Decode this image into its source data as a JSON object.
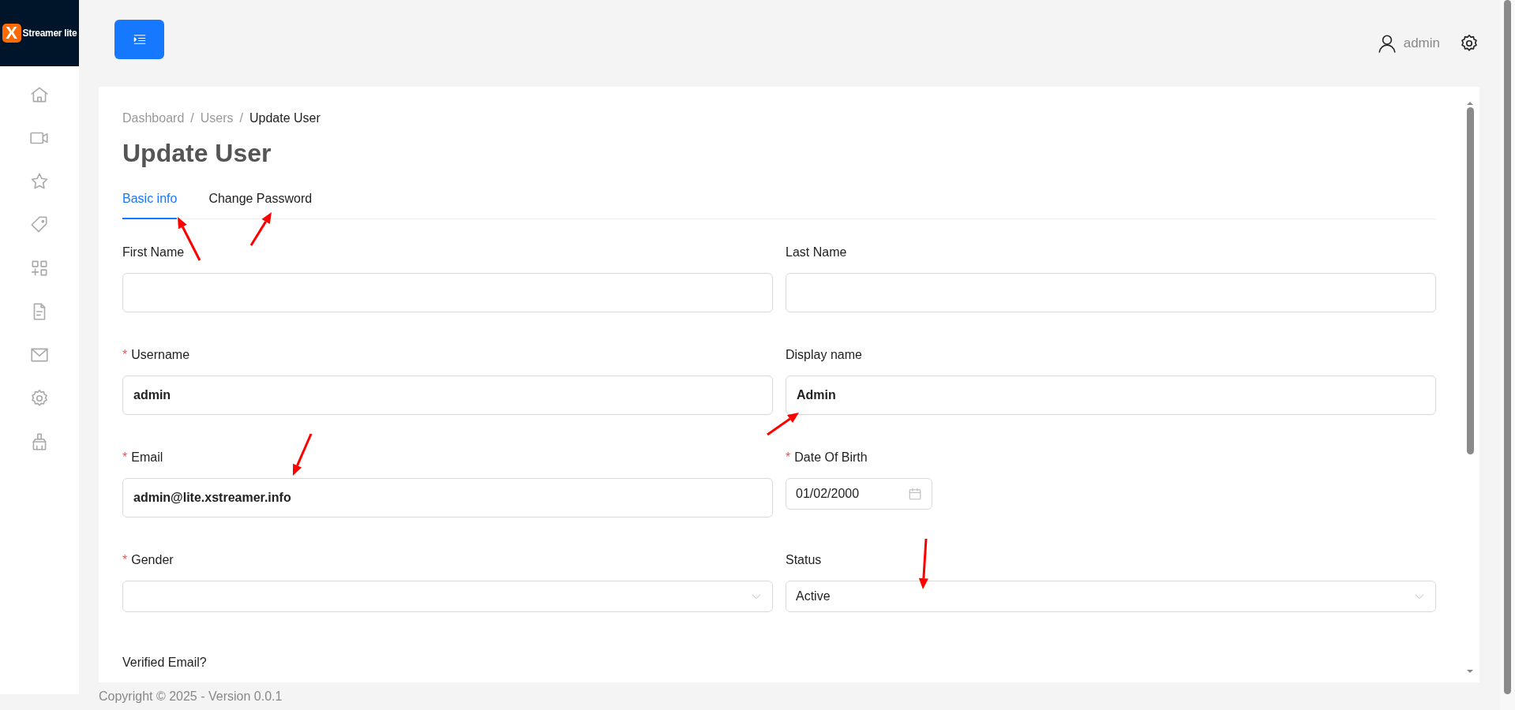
{
  "brand": {
    "mark": "X",
    "name": "Streamer lite"
  },
  "header": {
    "user": "admin"
  },
  "breadcrumb": [
    {
      "label": "Dashboard"
    },
    {
      "separator": "/",
      "label": "Users"
    },
    {
      "separator": "/",
      "label": "Update User"
    }
  ],
  "title": "Update User",
  "tabs": [
    {
      "label": "Basic info",
      "selected": true
    },
    {
      "label": "Change Password",
      "selected": false
    }
  ],
  "fields": [
    {
      "label": "First Name",
      "kind": "text"
    },
    {
      "label": "Last Name",
      "kind": "text"
    },
    {
      "required_mark": "*",
      "label": "Username",
      "kind": "text",
      "value": "admin"
    },
    {
      "label": "Display name",
      "kind": "text",
      "value": "Admin"
    },
    {
      "required_mark": "*",
      "label": "Email",
      "kind": "text",
      "value": "admin@lite.xstreamer.info"
    },
    {
      "required_mark": "*",
      "label": "Date Of Birth",
      "kind": "date",
      "value": "01/02/2000"
    },
    {
      "required_mark": "*",
      "label": "Gender",
      "kind": "select"
    },
    {
      "label": "Status",
      "kind": "select",
      "value": "Active"
    },
    {
      "label": "Verified Email?",
      "kind": "heading"
    }
  ],
  "footer": "Copyright © 2025 - Version 0.0.1"
}
